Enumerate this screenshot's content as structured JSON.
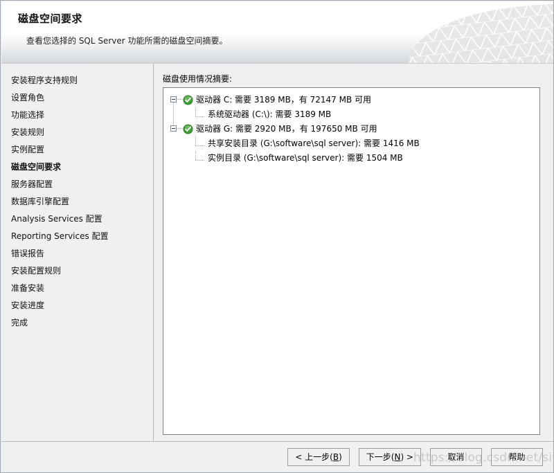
{
  "header": {
    "title": "磁盘空间要求",
    "subtitle": "查看您选择的 SQL Server 功能所需的磁盘空间摘要。",
    "deco_icon": "mesh-dome-pattern"
  },
  "sidebar": {
    "items": [
      {
        "label": "安装程序支持规则",
        "active": false
      },
      {
        "label": "设置角色",
        "active": false
      },
      {
        "label": "功能选择",
        "active": false
      },
      {
        "label": "安装规则",
        "active": false
      },
      {
        "label": "实例配置",
        "active": false
      },
      {
        "label": "磁盘空间要求",
        "active": true
      },
      {
        "label": "服务器配置",
        "active": false
      },
      {
        "label": "数据库引擎配置",
        "active": false
      },
      {
        "label": "Analysis Services 配置",
        "active": false
      },
      {
        "label": "Reporting Services 配置",
        "active": false
      },
      {
        "label": "错误报告",
        "active": false
      },
      {
        "label": "安装配置规则",
        "active": false
      },
      {
        "label": "准备安装",
        "active": false
      },
      {
        "label": "安装进度",
        "active": false
      },
      {
        "label": "完成",
        "active": false
      }
    ]
  },
  "content": {
    "section_label": "磁盘使用情况摘要:",
    "tree": [
      {
        "text": "驱动器 C: 需要 3189 MB，有 72147 MB 可用",
        "icon": "green-check-icon",
        "expanded": true,
        "children": [
          {
            "text": "系统驱动器 (C:\\): 需要 3189 MB"
          }
        ]
      },
      {
        "text": "驱动器 G: 需要 2920 MB，有 197650 MB 可用",
        "icon": "green-check-icon",
        "expanded": true,
        "children": [
          {
            "text": "共享安装目录 (G:\\software\\sql server): 需要 1416 MB"
          },
          {
            "text": "实例目录 (G:\\software\\sql server): 需要 1504 MB"
          }
        ]
      }
    ]
  },
  "footer": {
    "buttons": [
      {
        "name": "back-button",
        "prefix": "< 上一步(",
        "accel": "B",
        "suffix": ")"
      },
      {
        "name": "next-button",
        "prefix": "下一步(",
        "accel": "N",
        "suffix": ") >"
      },
      {
        "name": "cancel-button",
        "prefix": "取消",
        "accel": "",
        "suffix": ""
      },
      {
        "name": "help-button",
        "prefix": "帮助",
        "accel": "",
        "suffix": ""
      }
    ]
  },
  "watermark": {
    "text": "https://blog.csdn.net/siyla"
  },
  "colors": {
    "window_bg": "#f0f0f0",
    "panel_bg": "#ffffff",
    "panel_border": "#7c848c",
    "divider": "#b6bbc1",
    "status_green": "#3f9e36",
    "text": "#000000"
  }
}
